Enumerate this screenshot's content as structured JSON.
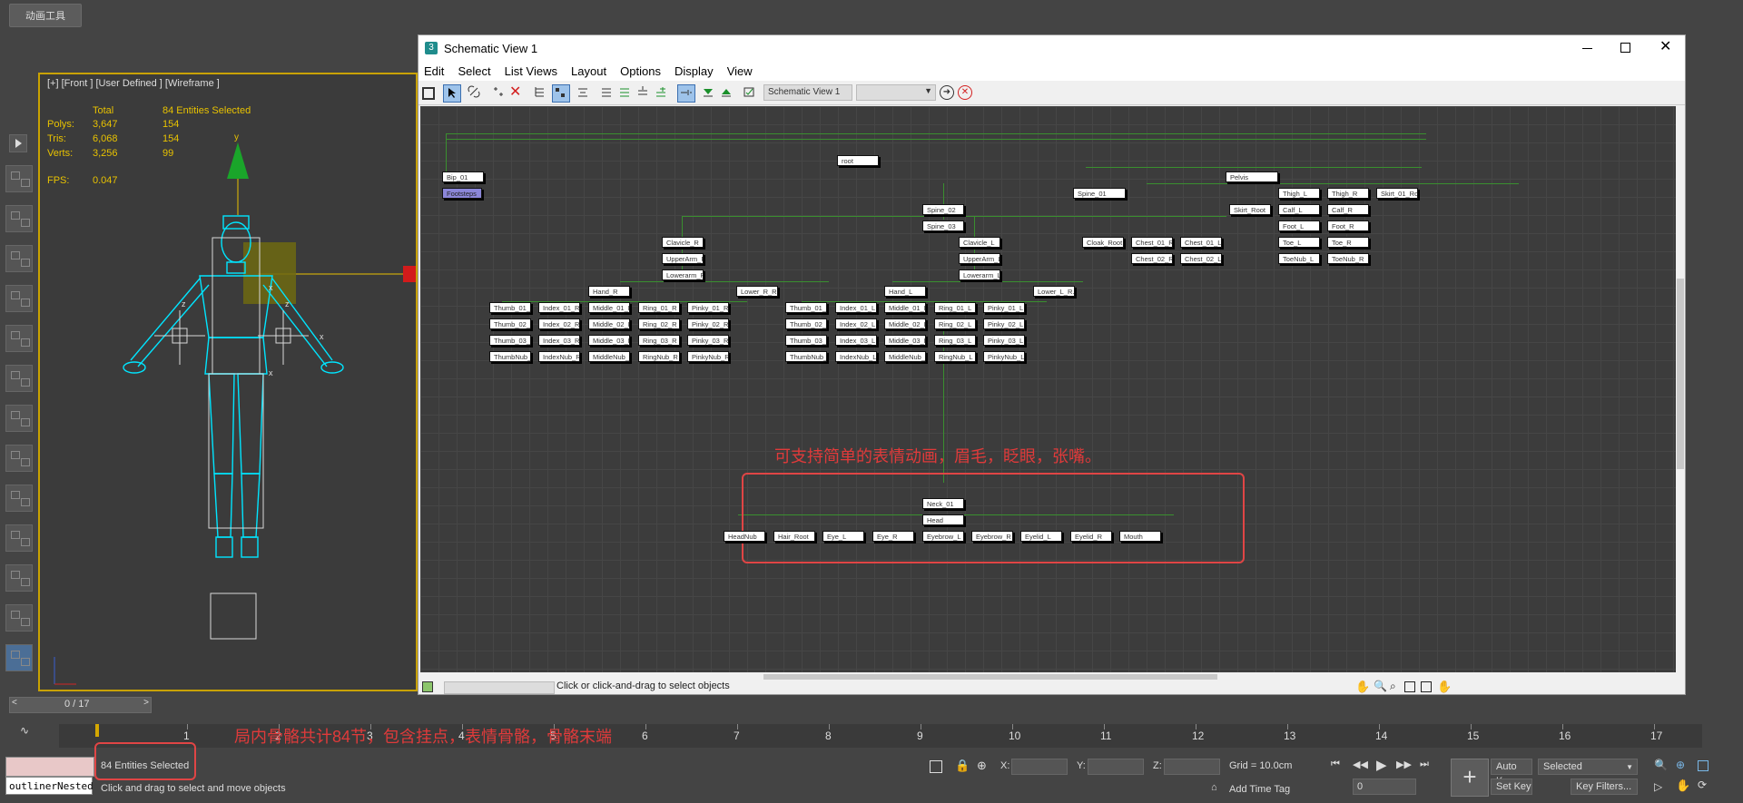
{
  "topbar": {
    "anim_tools": "动画工具"
  },
  "viewport": {
    "label": "[+] [Front ] [User Defined ] [Wireframe ]",
    "stats": {
      "header_total": "Total",
      "header_sel": "84 Entities Selected",
      "rows": [
        {
          "name": "Polys:",
          "total": "3,647",
          "sel": "154"
        },
        {
          "name": "Tris:",
          "total": "6,068",
          "sel": "154"
        },
        {
          "name": "Verts:",
          "total": "3,256",
          "sel": "99"
        }
      ],
      "fps_label": "FPS:",
      "fps_value": "0.047"
    },
    "axis_y": "y",
    "axis_x": "x",
    "axis_z": "z"
  },
  "schematic": {
    "title": "Schematic View 1",
    "menus": [
      "Edit",
      "Select",
      "List Views",
      "Layout",
      "Options",
      "Display",
      "View"
    ],
    "view_name": "Schematic View 1",
    "nodes": {
      "root": "root",
      "bip01": "Bip_01",
      "footsteps": "Footsteps",
      "pelvis": "Pelvis",
      "spine01": "Spine_01",
      "spine02": "Spine_02",
      "spine03": "Spine_03",
      "thigh_l": "Thigh_L",
      "thigh_r": "Thigh_R",
      "skirt01": "Skirt_01_Ro...",
      "skirt_root": "Skirt_Root",
      "calf_l": "Calf_L",
      "calf_r": "Calf_R",
      "foot_l": "Foot_L",
      "foot_r": "Foot_R",
      "toe_l": "Toe_L",
      "toe_r": "Toe_R",
      "toenub_l": "ToeNub_L",
      "toenub_r": "ToeNub_R",
      "clavicle_r": "Clavicle_R",
      "clavicle_l": "Clavicle_L",
      "cloak_root": "Cloak_Root",
      "chest01_r": "Chest_01_R",
      "chest01_l": "Chest_01_L",
      "chest02_r": "Chest_02_R",
      "chest02_l": "Chest_02_L",
      "upperarm_r": "UpperArm_R",
      "upperarm_l": "UpperArm_L",
      "lowerarm_r": "Lowerarm_R",
      "lowerarm_l": "Lowerarm_L",
      "hand_r": "Hand_R",
      "lower_r_r": "Lower_R_R...",
      "hand_l": "Hand_L",
      "lower_l_r": "Lower_L_R...",
      "neck01": "Neck_01",
      "head": "Head",
      "headnub": "HeadNub",
      "hair_root": "Hair_Root",
      "eye_l": "Eye_L",
      "eye_r": "Eye_R",
      "eyebrow_l": "Eyebrow_L",
      "eyebrow_r": "Eyebrow_R",
      "eyelid_l": "Eyelid_L",
      "eyelid_r": "Eyelid_R",
      "mouth": "Mouth"
    },
    "fingers_r": [
      [
        "Thumb_01_R",
        "Index_01_R",
        "Middle_01_R",
        "Ring_01_R",
        "Pinky_01_R"
      ],
      [
        "Thumb_02_R",
        "Index_02_R",
        "Middle_02_R",
        "Ring_02_R",
        "Pinky_02_R"
      ],
      [
        "Thumb_03_R",
        "Index_03_R",
        "Middle_03_R",
        "Ring_03_R",
        "Pinky_03_R"
      ],
      [
        "ThumbNub_R",
        "IndexNub_R",
        "MiddleNub_R",
        "RingNub_R",
        "PinkyNub_R"
      ]
    ],
    "fingers_l": [
      [
        "Thumb_01_L",
        "Index_01_L",
        "Middle_01_L",
        "Ring_01_L",
        "Pinky_01_L"
      ],
      [
        "Thumb_02_L",
        "Index_02_L",
        "Middle_02_L",
        "Ring_02_L",
        "Pinky_02_L"
      ],
      [
        "Thumb_03_L",
        "Index_03_L",
        "Middle_03_L",
        "Ring_03_L",
        "Pinky_03_L"
      ],
      [
        "ThumbNub_L",
        "IndexNub_L",
        "MiddleNub_L",
        "RingNub_L",
        "PinkyNub_L"
      ]
    ],
    "annotation_face": "可支持简单的表情动画，眉毛，眨眼，张嘴。",
    "status_text": "Click or click-and-drag to select objects"
  },
  "timeline": {
    "frame_counter": "0 / 17",
    "ticks": [
      "1",
      "2",
      "3",
      "4",
      "5",
      "6",
      "7",
      "8",
      "9",
      "10",
      "11",
      "12",
      "13",
      "14",
      "15",
      "16",
      "17"
    ],
    "annotation_bones": "局内骨骼共计84节，包含挂点，表情骨骼，骨骼末端"
  },
  "status": {
    "script_field": "outlinerNested",
    "selected_count": "84 Entities Selected",
    "prompt": "Click and drag to select and move objects",
    "x_label": "X:",
    "y_label": "Y:",
    "z_label": "Z:",
    "grid": "Grid = 10.0cm",
    "add_time_tag": "Add Time Tag",
    "auto_key": "Auto Key",
    "set_key": "Set Key",
    "selected_dropdown": "Selected",
    "key_filters": "Key Filters...",
    "frame_value": "0"
  }
}
